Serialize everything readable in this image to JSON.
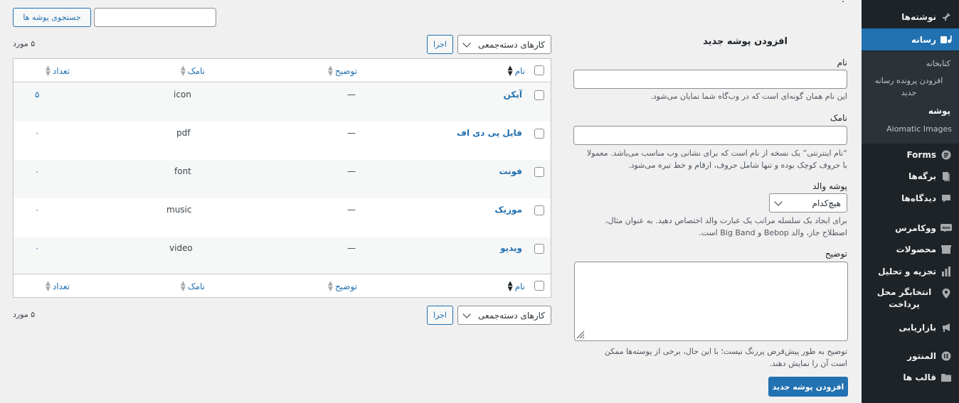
{
  "search": {
    "button_label": "جستجوی پوشه ها",
    "value": ""
  },
  "page_heading_fragment": "؛",
  "bulk": {
    "select_label": "کارهای دسته‌جمعی",
    "apply_label": "اجرا",
    "items_count": "۵ مورد"
  },
  "table": {
    "columns": {
      "name": "نام",
      "description": "توضیح",
      "slug": "نامک",
      "count": "تعداد"
    },
    "rows": [
      {
        "name": "آیکن",
        "description": "—",
        "slug": "icon",
        "count": "۵"
      },
      {
        "name": "فایل پی دی اف",
        "description": "—",
        "slug": "pdf",
        "count": "۰"
      },
      {
        "name": "فونت",
        "description": "—",
        "slug": "font",
        "count": "۰"
      },
      {
        "name": "موزیک",
        "description": "—",
        "slug": "music",
        "count": "۰"
      },
      {
        "name": "ویدیو",
        "description": "—",
        "slug": "video",
        "count": "۰"
      }
    ]
  },
  "form": {
    "heading": "افزودن پوشه جدید",
    "name_label": "نام",
    "name_help": "این نام همان گونه‌ای است که در وب‌گاه شما نمایان می‌شود.",
    "slug_label": "نامک",
    "slug_help_1": "“نام اینترنتی” یک نسخه از نام است که برای نشانی وب مناسب می‌باشد. معمولا",
    "slug_help_2": "با حروف کوچک بوده و تنها شامل حروف، ارقام و خط تیره می‌شود.",
    "parent_label": "پوشه والد",
    "parent_value": "هیچ‌کدام",
    "parent_help_1": "برای ایجاد یک سلسله مراتب یک عبارت والد اختصاص دهید. به عنوان مثال،",
    "parent_help_2": "اصطلاح جاز، والد Bebop و Big Band است.",
    "description_label": "توضیح",
    "description_help_1": "توضیح به طور پیش‌فرض پررنگ نیست؛ با این حال، برخی از پوسته‌ها ممکن",
    "description_help_2": "است آن را نمایش دهند.",
    "submit_label": "افزودن پوشه جدید"
  },
  "sidebar": {
    "posts": "نوشته‌ها",
    "media": "رسانه",
    "submenu": {
      "library": "کتابخانه",
      "add_new": "افزودن پرونده رسانه جدید",
      "folder": "پوشه",
      "aiomatic": "Aiomatic Images"
    },
    "forms": "Forms",
    "pages": "برگه‌ها",
    "comments": "دیدگاه‌ها",
    "woocommerce": "ووکامرس",
    "products": "محصولات",
    "analytics": "تجزیه و تحلیل",
    "payment_selector": "انتخابگر محل پرداخت",
    "marketing": "بازاریابی",
    "elementor": "المنتور",
    "templates": "قالب ها"
  },
  "colors": {
    "accent": "#2271b1",
    "sidebar_bg": "#1d2327",
    "page_bg": "#f0f0f1"
  }
}
